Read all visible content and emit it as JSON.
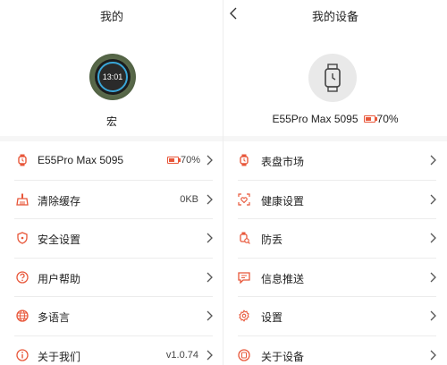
{
  "left": {
    "title": "我的",
    "user_name": "宏",
    "watch_face_time": "13:01",
    "items": [
      {
        "label": "E55Pro Max 5095",
        "value": "70%",
        "icon": "watch-icon",
        "battery": true
      },
      {
        "label": "清除缓存",
        "value": "0KB",
        "icon": "broom-icon"
      },
      {
        "label": "安全设置",
        "value": "",
        "icon": "shield-icon"
      },
      {
        "label": "用户帮助",
        "value": "",
        "icon": "help-icon"
      },
      {
        "label": "多语言",
        "value": "",
        "icon": "globe-icon"
      },
      {
        "label": "关于我们",
        "value": "v1.0.74",
        "icon": "info-icon"
      }
    ]
  },
  "right": {
    "title": "我的设备",
    "device_name": "E55Pro Max 5095",
    "battery": "70%",
    "items": [
      {
        "label": "表盘市场",
        "icon": "watch-icon"
      },
      {
        "label": "健康设置",
        "icon": "health-icon"
      },
      {
        "label": "防丢",
        "icon": "anti-lost-icon"
      },
      {
        "label": "信息推送",
        "icon": "message-icon"
      },
      {
        "label": "设置",
        "icon": "gear-icon"
      },
      {
        "label": "关于设备",
        "icon": "about-icon"
      }
    ]
  },
  "colors": {
    "accent": "#e8573a",
    "battery_fill": "#e8573a",
    "gap": "#f6f6f6"
  }
}
